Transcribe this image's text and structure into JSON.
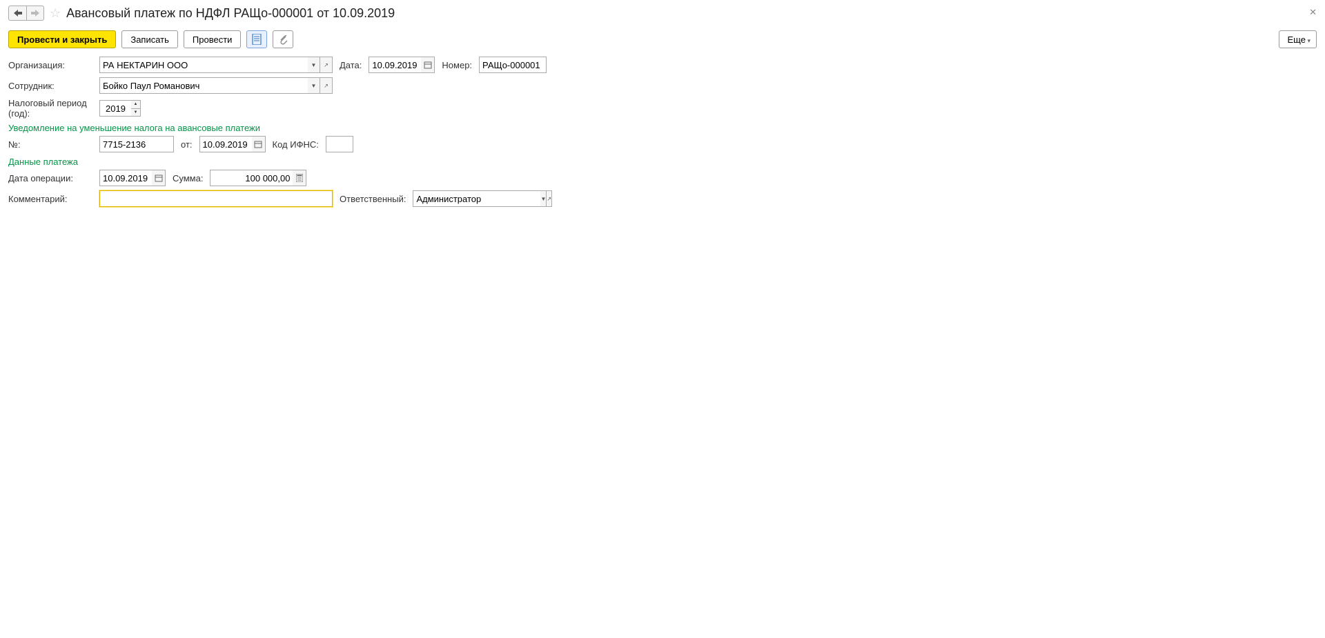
{
  "header": {
    "title": "Авансовый платеж по НДФЛ РАЩо-000001 от 10.09.2019"
  },
  "toolbar": {
    "post_close": "Провести и закрыть",
    "save": "Записать",
    "post": "Провести",
    "more": "Еще"
  },
  "labels": {
    "organization": "Организация:",
    "date": "Дата:",
    "number": "Номер:",
    "employee": "Сотрудник:",
    "tax_year": "Налоговый период (год):",
    "section_notice": "Уведомление на уменьшение налога на авансовые платежи",
    "notice_no": "№:",
    "notice_from": "от:",
    "ifns_code": "Код ИФНС:",
    "section_payment": "Данные платежа",
    "op_date": "Дата операции:",
    "sum": "Сумма:",
    "comment": "Комментарий:",
    "responsible": "Ответственный:"
  },
  "fields": {
    "organization": "РА НЕКТАРИН ООО",
    "date": "10.09.2019",
    "number": "РАЩо-000001",
    "employee": "Бойко Паул Романович",
    "tax_year": "2019",
    "notice_no": "7715-2136",
    "notice_date": "10.09.2019",
    "ifns_code": "",
    "op_date": "10.09.2019",
    "sum": "100 000,00",
    "comment": "",
    "responsible": "Администратор"
  }
}
